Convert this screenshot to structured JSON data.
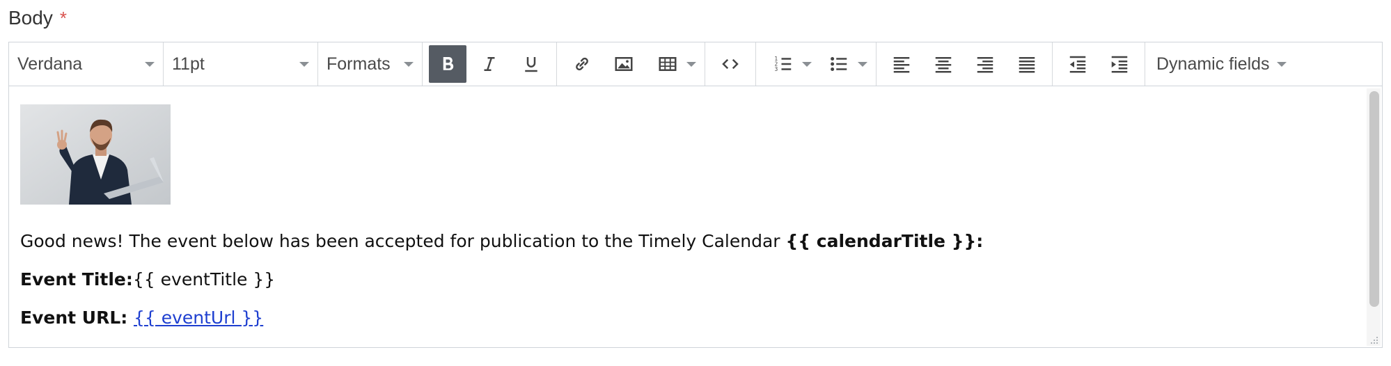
{
  "field": {
    "label": "Body",
    "required_mark": "*"
  },
  "toolbar": {
    "font_family": "Verdana",
    "font_size": "11pt",
    "formats_label": "Formats",
    "dynamic_fields_label": "Dynamic fields",
    "buttons": {
      "bold": {
        "icon": "bold-icon",
        "active": true
      },
      "italic": {
        "icon": "italic-icon"
      },
      "underline": {
        "icon": "underline-icon"
      },
      "link": {
        "icon": "link-icon"
      },
      "image": {
        "icon": "image-icon"
      },
      "table": {
        "icon": "table-icon"
      },
      "code": {
        "icon": "code-icon"
      },
      "numbered_list": {
        "icon": "numbered-list-icon"
      },
      "bullet_list": {
        "icon": "bullet-list-icon"
      },
      "align_left": {
        "icon": "align-left-icon"
      },
      "align_center": {
        "icon": "align-center-icon"
      },
      "align_right": {
        "icon": "align-right-icon"
      },
      "justify": {
        "icon": "justify-icon"
      },
      "outdent": {
        "icon": "outdent-icon"
      },
      "indent": {
        "icon": "indent-icon"
      }
    }
  },
  "content": {
    "image_alt": "Man holding laptop giving OK sign",
    "p1_text": "Good news! The event below has been accepted for publication to the Timely Calendar ",
    "p1_bold": "{{ calendarTitle }}:",
    "p2_label": "Event Title:",
    "p2_value": "{{ eventTitle }}",
    "p3_label": "Event URL: ",
    "p3_link": "{{ eventUrl }}"
  },
  "colors": {
    "required": "#d9534f",
    "link": "#1e3fd0",
    "active_button": "#555b63"
  }
}
